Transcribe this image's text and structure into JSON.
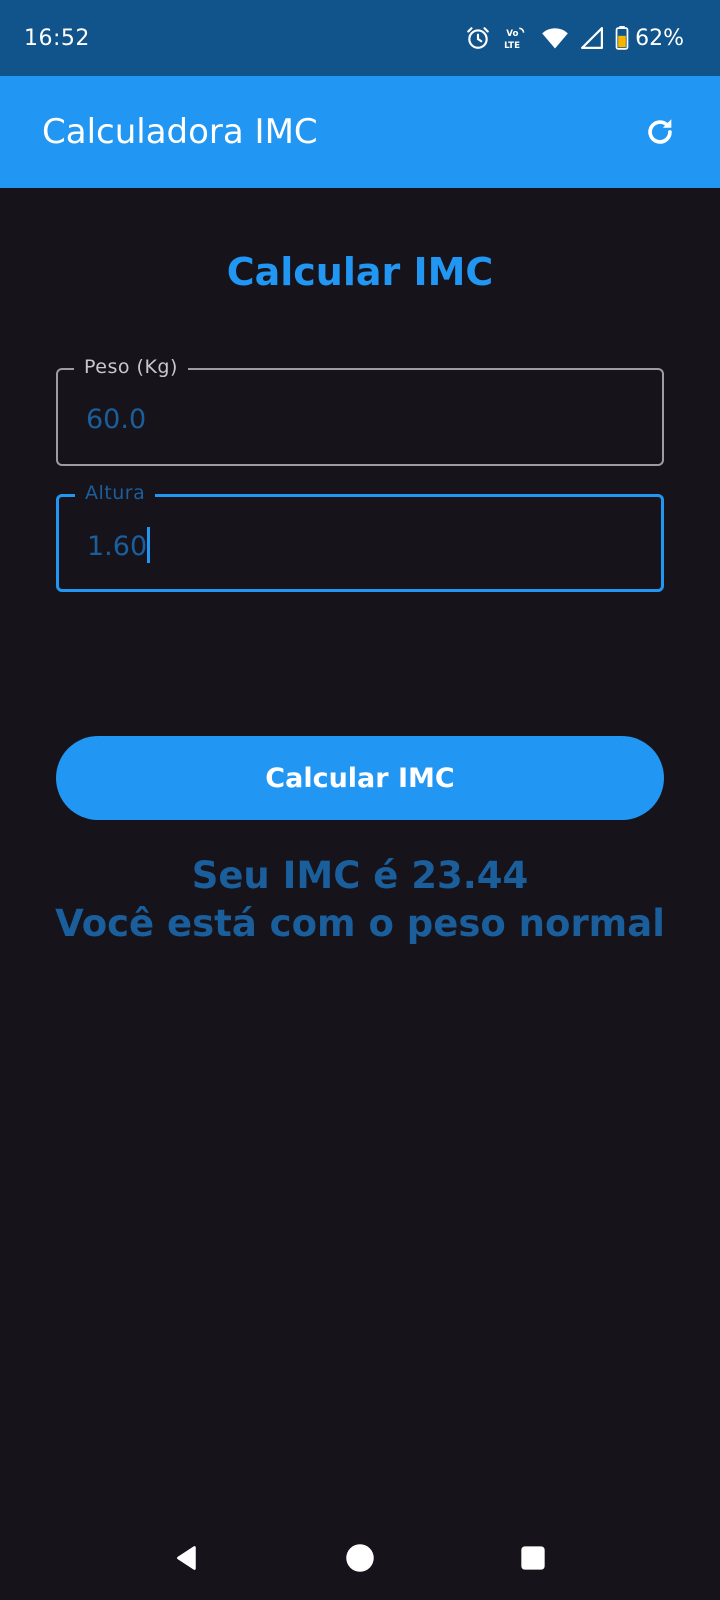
{
  "status_bar": {
    "time": "16:52",
    "volte_label": "Vo LTE",
    "battery_percent": "62%",
    "icons": [
      "alarm-icon",
      "volte-icon",
      "wifi-icon",
      "cell-signal-icon",
      "battery-icon"
    ]
  },
  "app_bar": {
    "title": "Calculadora IMC",
    "refresh_icon": "refresh-icon"
  },
  "main": {
    "heading": "Calcular IMC",
    "weight_field": {
      "label": "Peso (Kg)",
      "value": "60.0"
    },
    "height_field": {
      "label": "Altura",
      "value": "1.60"
    },
    "calculate_button": "Calcular IMC",
    "result_line_1": "Seu IMC é 23.44",
    "result_line_2": "Você está com o peso normal"
  },
  "nav_bar": {
    "icons": [
      "back-icon",
      "home-icon",
      "recents-icon"
    ]
  },
  "colors": {
    "accent": "#2196f3",
    "status_bar": "#10548b",
    "background": "#16141a",
    "result_text": "#1a5e9c"
  }
}
